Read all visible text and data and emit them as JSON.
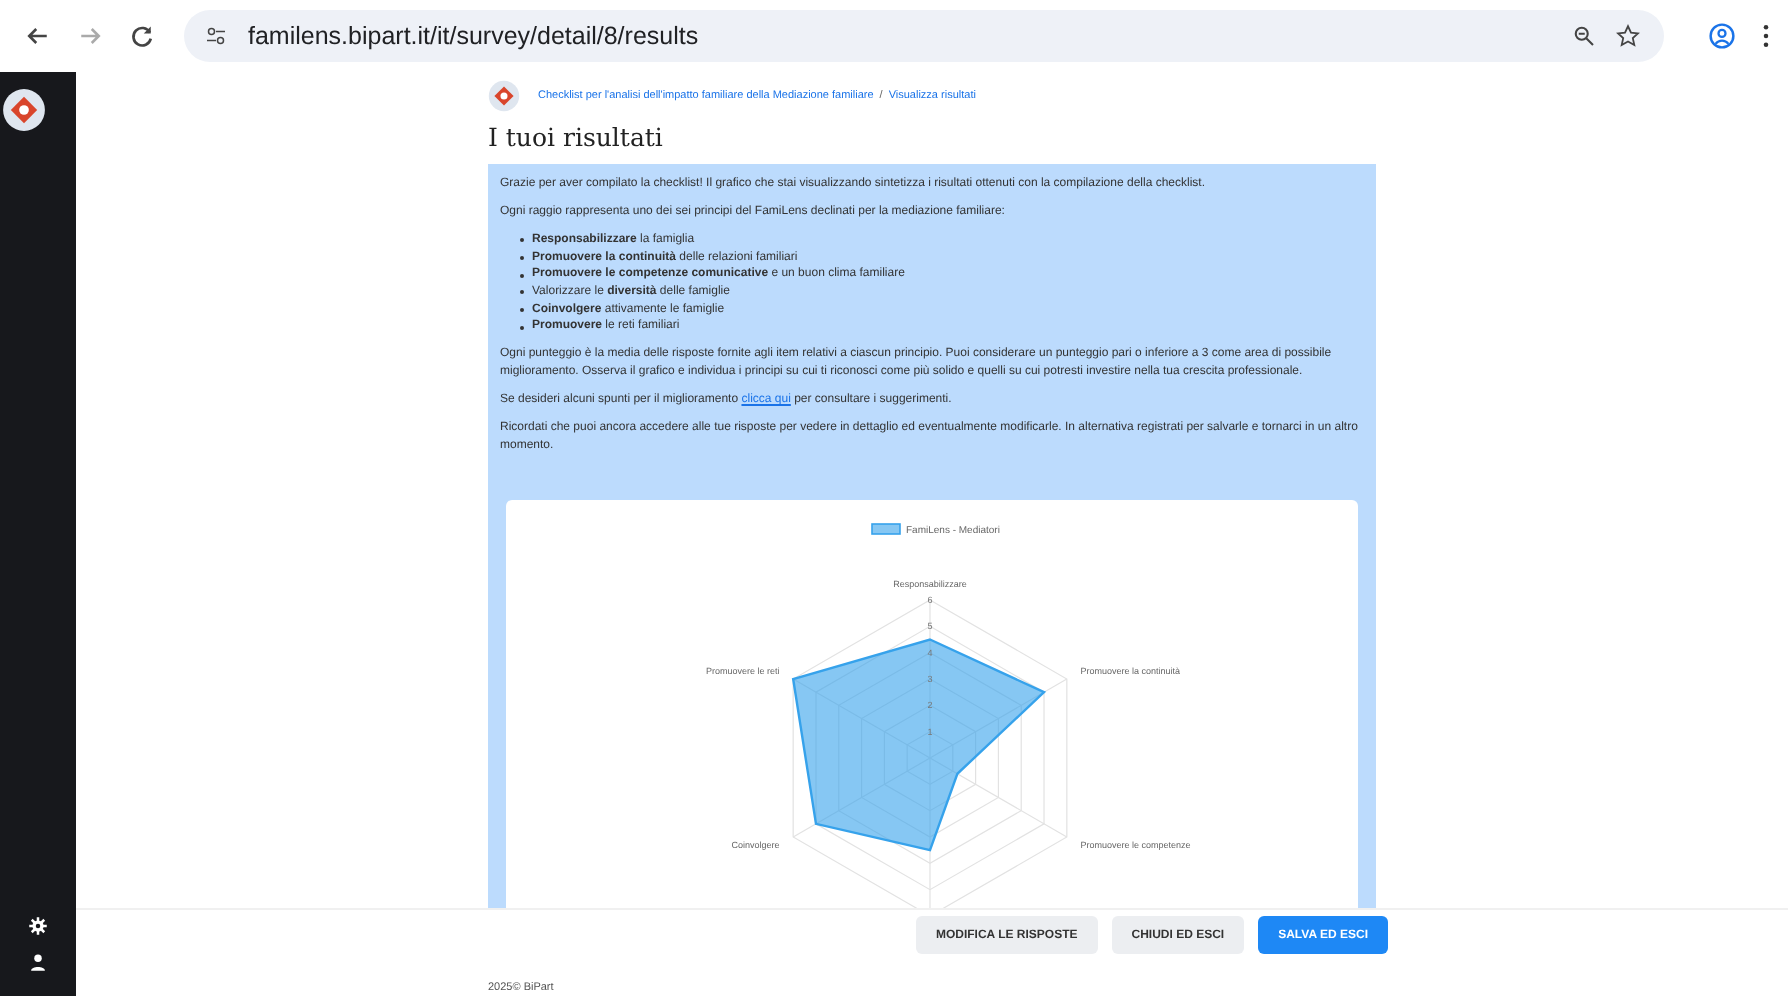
{
  "browser": {
    "url": "familens.bipart.it/it/survey/detail/8/results"
  },
  "breadcrumb": [
    "Checklist per l'analisi dell'impatto familiare della Mediazione familiare",
    "Visualizza risultati"
  ],
  "breadcrumb_separator": "/",
  "title": "I tuoi risultati",
  "info": {
    "intro": "Grazie per aver compilato la checklist! Il grafico che stai visualizzando sintetizza i risultati ottenuti con la compilazione della checklist.",
    "principles_intro": "Ogni raggio rappresenta uno dei sei principi del FamiLens declinati per la mediazione familiare:",
    "principles": [
      "**Responsabilizzare** la famiglia",
      "**Promuovere la continuità** delle relazioni familiari",
      "**Promuovere le competenze comunicative** e un buon clima familiare",
      "Valorizzare le **diversità** delle famiglie",
      "**Coinvolgere** attivamente le famiglie",
      "**Promuovere** le reti familiari"
    ],
    "score_note": "Ogni punteggio è la media delle risposte fornite agli item relativi a ciascun principio. Puoi considerare un punteggio pari o inferiore a 3 come area di possibile miglioramento. Osserva il grafico e individua i principi su cui ti riconosci come più solido e quelli su cui potresti investire nella tua crescita professionale.",
    "tips_before": "Se desideri alcuni spunti per il miglioramento",
    "tips_link": "clicca qui",
    "tips_after": "per consultare i suggerimenti.",
    "reminder": "Ricordati che puoi ancora accedere alle tue risposte per vedere in dettaglio ed eventualmente modificarle. In alternativa registrati per salvarle e tornarci in un altro momento."
  },
  "chart": {
    "legend": "FamiLens - Mediatori",
    "tick_labels": [
      "6",
      "5",
      "4",
      "3",
      "2",
      "1"
    ],
    "axis_labels": [
      "Responsabilizzare",
      "Promuovere le reti",
      "Promuovere la continuità",
      "Coinvolgere",
      "Promuovere le competenze"
    ]
  },
  "buttons": [
    {
      "label": "MODIFICA LE RISPOSTE",
      "kind": "secondary"
    },
    {
      "label": "CHIUDI ED ESCI",
      "kind": "secondary"
    },
    {
      "label": "SALVA ED ESCI",
      "kind": "primary"
    }
  ],
  "footer": "2025© BiPart"
}
